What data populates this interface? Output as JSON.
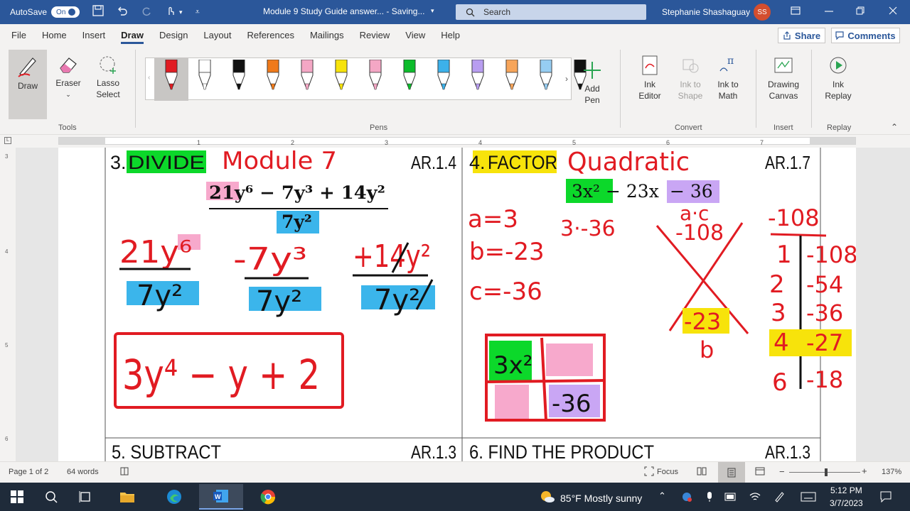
{
  "titlebar": {
    "autosave_label": "AutoSave",
    "autosave_state": "On",
    "document_title": "Module 9 Study Guide answer...  -  Saving...",
    "search_placeholder": "Search",
    "user_name": "Stephanie Shashaguay",
    "user_initials": "SS"
  },
  "menu": {
    "items": [
      "File",
      "Home",
      "Insert",
      "Draw",
      "Design",
      "Layout",
      "References",
      "Mailings",
      "Review",
      "View",
      "Help"
    ],
    "active": "Draw",
    "share": "Share",
    "comments": "Comments"
  },
  "ribbon": {
    "tools": {
      "draw": "Draw",
      "eraser": "Eraser",
      "lasso_1": "Lasso",
      "lasso_2": "Select",
      "group": "Tools"
    },
    "pens_group": "Pens",
    "pen_colors": [
      "#e11b22",
      "#ffffff",
      "#111111",
      "#f07a1a",
      "#f4a7c5",
      "#f7e30b",
      "#f4a7c5",
      "#0cbc2b",
      "#3cb1ea",
      "#b89df0",
      "#f7a55a",
      "#96cdf2",
      "#111111"
    ],
    "add_pen_1": "Add",
    "add_pen_2": "Pen",
    "convert": {
      "ink_editor_1": "Ink",
      "ink_editor_2": "Editor",
      "ink_shape_1": "Ink to",
      "ink_shape_2": "Shape",
      "ink_math_1": "Ink to",
      "ink_math_2": "Math",
      "group": "Convert"
    },
    "insert": {
      "canvas_1": "Drawing",
      "canvas_2": "Canvas",
      "group": "Insert"
    },
    "replay": {
      "label_1": "Ink",
      "label_2": "Replay",
      "group": "Replay"
    }
  },
  "ruler_numbers": [
    "1",
    "2",
    "3",
    "4",
    "5",
    "6",
    "7"
  ],
  "left_ruler_numbers": [
    "3",
    "4",
    "5",
    "6"
  ],
  "document": {
    "q3_heading": "3.",
    "q3_word": "DIVIDE",
    "q3_standard": "AR.1.4",
    "q3_numerator": "21y⁶ − 7y³ + 14y²",
    "q3_denominator": "7y²",
    "q4_heading": "4.",
    "q4_word": "FACTOR",
    "q4_standard": "AR.1.7",
    "q4_expression_a": "3x²",
    "q4_expression_b": " − 23x ",
    "q4_expression_c": "− 36",
    "q5_heading": "5. SUBTRACT",
    "q5_standard": "AR.1.3",
    "q6_heading": "6. FIND THE PRODUCT",
    "q6_standard": "AR.1.3",
    "ink": {
      "module": "Module 7",
      "quadratic": "Quadratic",
      "term1": "21y⁶",
      "term2": "-7y³",
      "term3": "+14y²",
      "den": "7y²",
      "answer": "3y⁴ − y + 2",
      "a": "a=3",
      "b": "b=-23",
      "c": "c=-36",
      "ac_product": "3·-36",
      "ac_label": "a·c",
      "ac_value": "-108",
      "b_value": "-23",
      "b_letter": "b",
      "table_head": "-108",
      "factors_left": [
        "1",
        "2",
        "3",
        "4",
        "6"
      ],
      "factors_right": [
        "-108",
        "-54",
        "-36",
        "-27",
        "-18"
      ],
      "box_tl": "3x²",
      "box_br": "-36"
    }
  },
  "status": {
    "page": "Page 1 of 2",
    "words": "64 words",
    "focus": "Focus",
    "zoom": "137%"
  },
  "taskbar": {
    "weather": "85°F  Mostly sunny",
    "time": "5:12 PM",
    "date": "3/7/2023"
  }
}
